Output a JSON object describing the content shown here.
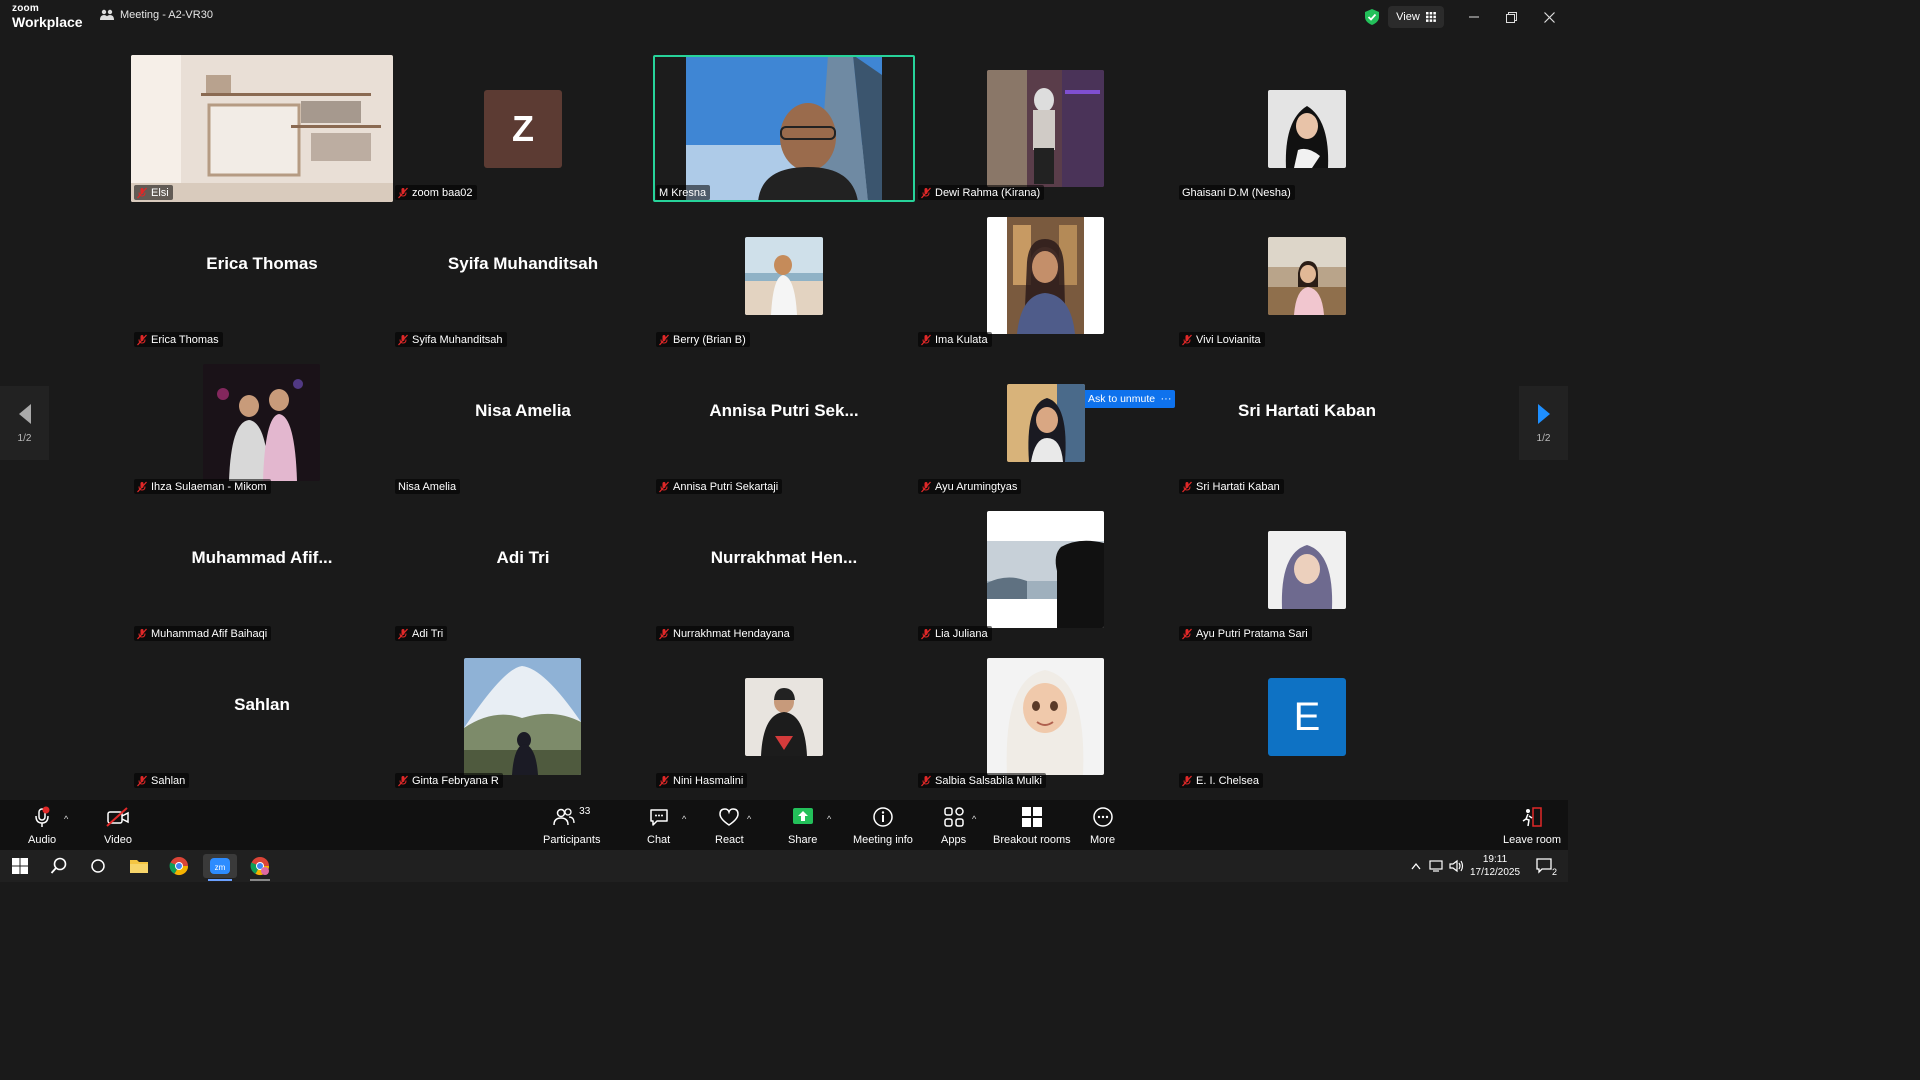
{
  "app": {
    "logo_line1": "zoom",
    "logo_line2": "Workplace",
    "meeting_title": "Meeting - A2-VR30",
    "view_label": "View"
  },
  "ask_to_unmute": "Ask to unmute",
  "ask_more": "···",
  "pager": {
    "left": "1/2",
    "right": "1/2"
  },
  "participants": [
    {
      "name": "Elsi",
      "muted": true,
      "kind": "video"
    },
    {
      "name": "zoom baa02",
      "muted": true,
      "kind": "letter",
      "letter": "Z",
      "letter_color": "#5c3b33"
    },
    {
      "name": "M Kresna",
      "muted": false,
      "kind": "video",
      "active": true
    },
    {
      "name": "Dewi Rahma (Kirana)",
      "muted": true,
      "kind": "photo"
    },
    {
      "name": "Ghaisani D.M (Nesha)",
      "muted": false,
      "kind": "photo"
    },
    {
      "name": "Erica Thomas",
      "muted": true,
      "kind": "name",
      "display": "Erica Thomas"
    },
    {
      "name": "Syifa Muhanditsah",
      "muted": true,
      "kind": "name",
      "display": "Syifa Muhanditsah"
    },
    {
      "name": "Berry (Brian B)",
      "muted": true,
      "kind": "photo"
    },
    {
      "name": "Ima Kulata",
      "muted": true,
      "kind": "photo"
    },
    {
      "name": "Vivi Lovianita",
      "muted": true,
      "kind": "photo"
    },
    {
      "name": "Ihza Sulaeman - Mikom",
      "muted": true,
      "kind": "photo"
    },
    {
      "name": "Nisa Amelia",
      "muted": false,
      "kind": "name",
      "display": "Nisa Amelia"
    },
    {
      "name": "Annisa Putri Sekartaji",
      "muted": true,
      "kind": "name",
      "display": "Annisa  Putri  Sek..."
    },
    {
      "name": "Ayu Arumingtyas",
      "muted": true,
      "kind": "photo"
    },
    {
      "name": "Sri Hartati Kaban",
      "muted": true,
      "kind": "name",
      "display": "Sri Hartati Kaban"
    },
    {
      "name": "Muhammad Afif Baihaqi",
      "muted": true,
      "kind": "name",
      "display": "Muhammad  Afif..."
    },
    {
      "name": "Adi Tri",
      "muted": true,
      "kind": "name",
      "display": "Adi Tri"
    },
    {
      "name": "Nurrakhmat Hendayana",
      "muted": true,
      "kind": "name",
      "display": "Nurrakhmat  Hen..."
    },
    {
      "name": "Lia Juliana",
      "muted": true,
      "kind": "photo"
    },
    {
      "name": "Ayu Putri Pratama Sari",
      "muted": true,
      "kind": "photo"
    },
    {
      "name": "Sahlan",
      "muted": true,
      "kind": "name",
      "display": "Sahlan"
    },
    {
      "name": "Ginta Febryana R",
      "muted": true,
      "kind": "photo"
    },
    {
      "name": "Nini Hasmalini",
      "muted": true,
      "kind": "photo"
    },
    {
      "name": "Salbia Salsabila Mulki",
      "muted": true,
      "kind": "photo"
    },
    {
      "name": "E. I. Chelsea",
      "muted": true,
      "kind": "letter",
      "letter": "E",
      "letter_color": "#0e72c4"
    }
  ],
  "toolbar": {
    "audio": "Audio",
    "video": "Video",
    "participants": "Participants",
    "participants_count": "33",
    "chat": "Chat",
    "react": "React",
    "share": "Share",
    "meeting_info": "Meeting info",
    "apps": "Apps",
    "breakout_rooms": "Breakout rooms",
    "more": "More",
    "leave_room": "Leave room"
  },
  "taskbar": {
    "time": "19:11",
    "date": "17/12/2025",
    "notifications": "2"
  },
  "colors": {
    "active_speaker": "#27d39a",
    "accent": "#0e72ed",
    "share_green": "#23c05a",
    "muted_red": "#e02828"
  }
}
